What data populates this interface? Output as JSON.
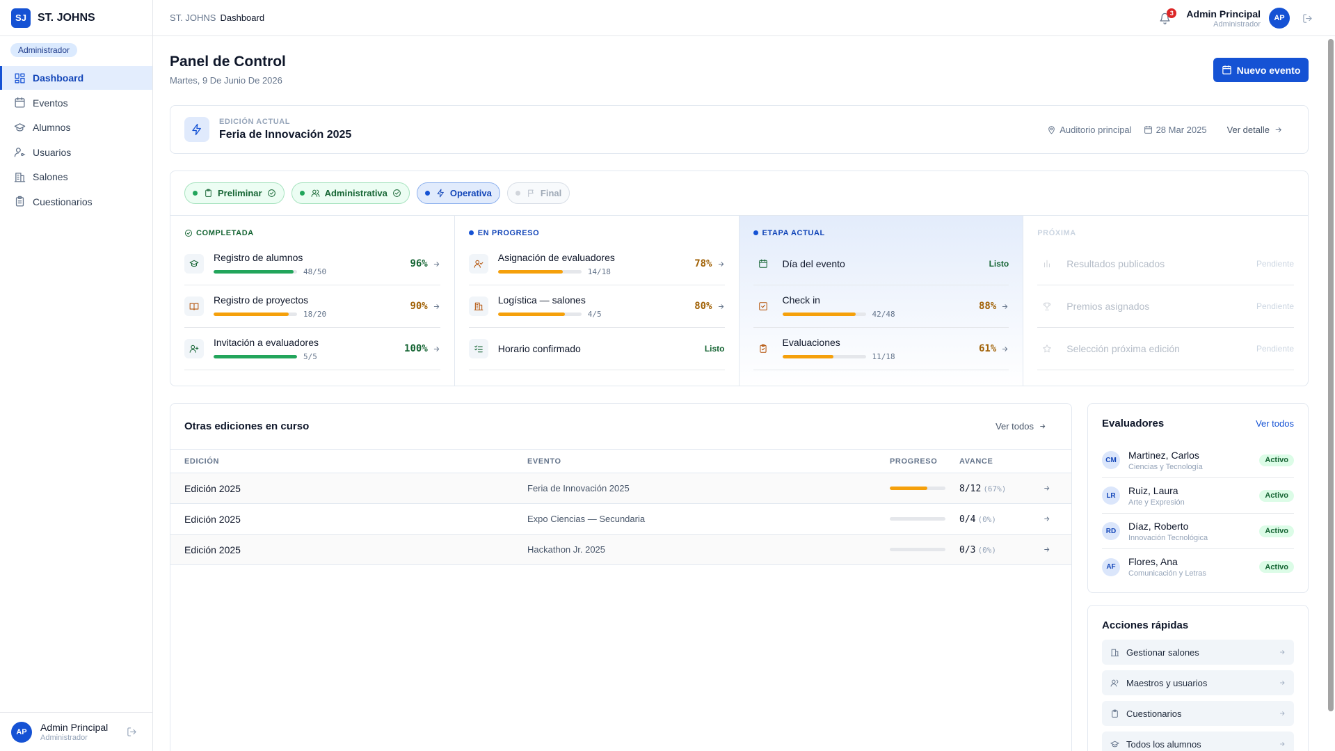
{
  "brand": {
    "logo": "SJ",
    "name": "ST. JOHNS"
  },
  "sidebar": {
    "role": "Administrador",
    "items": [
      {
        "label": "Dashboard",
        "icon": "dashboard-icon",
        "active": true
      },
      {
        "label": "Eventos",
        "icon": "calendar-icon"
      },
      {
        "label": "Alumnos",
        "icon": "graduation-cap-icon"
      },
      {
        "label": "Usuarios",
        "icon": "user-key-icon"
      },
      {
        "label": "Salones",
        "icon": "building-icon"
      },
      {
        "label": "Cuestionarios",
        "icon": "clipboard-icon"
      }
    ],
    "user": {
      "initials": "AP",
      "name": "Admin Principal",
      "role": "Administrador"
    }
  },
  "topbar": {
    "crumb_root": "ST. JOHNS",
    "crumb_current": "Dashboard",
    "notifications": "3",
    "user": {
      "name": "Admin Principal",
      "role": "Administrador",
      "initials": "AP"
    }
  },
  "page": {
    "title": "Panel de Control",
    "date": "Martes, 9 De Junio De 2026",
    "new_event": "Nuevo evento"
  },
  "edition": {
    "label": "EDICIÓN ACTUAL",
    "name": "Feria de Innovación 2025",
    "location": "Auditorio principal",
    "date": "28 Mar 2025",
    "detail_link": "Ver detalle"
  },
  "stages": {
    "chips": [
      {
        "label": "Preliminar",
        "state": "done",
        "icon": "clipboard-icon"
      },
      {
        "label": "Administrativa",
        "state": "done",
        "icon": "users-icon"
      },
      {
        "label": "Operativa",
        "state": "current",
        "icon": "bolt-icon"
      },
      {
        "label": "Final",
        "state": "next",
        "icon": "flag-icon"
      }
    ],
    "columns": [
      {
        "header": "COMPLETADA",
        "tasks": [
          {
            "name": "Registro de alumnos",
            "count": "48/50",
            "pct": "96%",
            "progress": 0.96,
            "color": "#22a55b"
          },
          {
            "name": "Registro de proyectos",
            "count": "18/20",
            "pct": "90%",
            "progress": 0.9,
            "color": "#f5a00b"
          },
          {
            "name": "Invitación a evaluadores",
            "count": "5/5",
            "pct": "100%",
            "progress": 1.0,
            "color": "#22a55b"
          }
        ]
      },
      {
        "header": "EN PROGRESO",
        "tasks": [
          {
            "name": "Asignación de evaluadores",
            "count": "14/18",
            "pct": "78%",
            "progress": 0.78,
            "color": "#f5a00b"
          },
          {
            "name": "Logística — salones",
            "count": "4/5",
            "pct": "80%",
            "progress": 0.8,
            "color": "#f5a00b"
          },
          {
            "name": "Horario confirmado",
            "status": "Listo"
          }
        ]
      },
      {
        "header": "ETAPA ACTUAL",
        "tasks": [
          {
            "name": "Día del evento",
            "status": "Listo"
          },
          {
            "name": "Check in",
            "count": "42/48",
            "pct": "88%",
            "progress": 0.88,
            "color": "#f5a00b"
          },
          {
            "name": "Evaluaciones",
            "count": "11/18",
            "pct": "61%",
            "progress": 0.61,
            "color": "#f5a00b"
          }
        ]
      },
      {
        "header": "PRÓXIMA",
        "tasks": [
          {
            "name": "Resultados publicados",
            "status": "Pendiente"
          },
          {
            "name": "Premios asignados",
            "status": "Pendiente"
          },
          {
            "name": "Selección próxima edición",
            "status": "Pendiente"
          }
        ]
      }
    ]
  },
  "others": {
    "title": "Otras ediciones en curso",
    "link": "Ver todos",
    "headers": [
      "EDICIÓN",
      "EVENTO",
      "PROGRESO",
      "AVANCE"
    ],
    "rows": [
      {
        "edition": "Edición 2025",
        "event": "Feria de Innovación 2025",
        "progress": 0.67,
        "count": "8/12",
        "pct": "(67%)"
      },
      {
        "edition": "Edición 2025",
        "event": "Expo Ciencias — Secundaria",
        "progress": 0,
        "count": "0/4",
        "pct": "(0%)"
      },
      {
        "edition": "Edición 2025",
        "event": "Hackathon Jr. 2025",
        "progress": 0,
        "count": "0/3",
        "pct": "(0%)"
      }
    ]
  },
  "evaluators": {
    "title": "Evaluadores",
    "link": "Ver todos",
    "list": [
      {
        "initials": "CM",
        "name": "Martinez, Carlos",
        "area": "Ciencias y Tecnología",
        "status": "Activo"
      },
      {
        "initials": "LR",
        "name": "Ruiz, Laura",
        "area": "Arte y Expresión",
        "status": "Activo"
      },
      {
        "initials": "RD",
        "name": "Díaz, Roberto",
        "area": "Innovación Tecnológica",
        "status": "Activo"
      },
      {
        "initials": "AF",
        "name": "Flores, Ana",
        "area": "Comunicación y Letras",
        "status": "Activo"
      }
    ]
  },
  "quick": {
    "title": "Acciones rápidas",
    "items": [
      {
        "label": "Gestionar salones",
        "icon": "building-icon"
      },
      {
        "label": "Maestros y usuarios",
        "icon": "users-icon"
      },
      {
        "label": "Cuestionarios",
        "icon": "clipboard-icon"
      },
      {
        "label": "Todos los alumnos",
        "icon": "graduation-cap-icon"
      }
    ]
  }
}
